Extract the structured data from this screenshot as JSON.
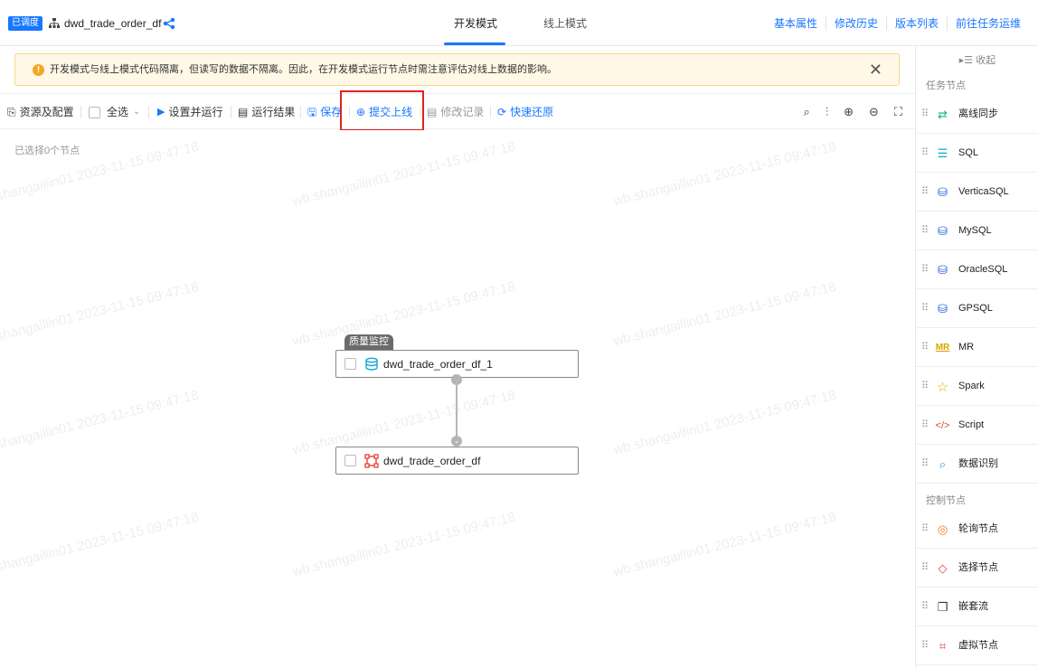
{
  "header": {
    "badge": "已调度",
    "job_title": "dwd_trade_order_df",
    "mode_tabs": {
      "dev": "开发模式",
      "online": "线上模式"
    },
    "links": [
      "基本属性",
      "修改历史",
      "版本列表",
      "前往任务运维"
    ]
  },
  "notice": {
    "text": "开发模式与线上模式代码隔离，但读写的数据不隔离。因此，在开发模式运行节点时需注意评估对线上数据的影响。",
    "close": "✕"
  },
  "toolbar": {
    "resources": "资源及配置",
    "select_all": "全选",
    "set_and_run": "设置并运行",
    "run_result": "运行结果",
    "save": "保存",
    "submit_online": "提交上线",
    "modify_record": "修改记录",
    "quick_restore": "快速还原"
  },
  "canvas": {
    "selected_count": "已选择0个节点",
    "watermark": "wb.shangaillin01 2023-11-15 09:47:18",
    "node_tag": "质量监控",
    "nodes": [
      "dwd_trade_order_df_1",
      "dwd_trade_order_df"
    ]
  },
  "sidebar": {
    "collapse": "▸☰ 收起",
    "task_section": "任务节点",
    "task_items": [
      "离线同步",
      "SQL",
      "VerticaSQL",
      "MySQL",
      "OracleSQL",
      "GPSQL",
      "MR",
      "Spark",
      "Script",
      "数据识别"
    ],
    "control_section": "控制节点",
    "control_items": [
      "轮询节点",
      "选择节点",
      "嵌套流",
      "虚拟节点"
    ]
  },
  "colors": {
    "accent": "#1677ff",
    "highlight": "#e0211f",
    "warning": "#f5a623"
  }
}
